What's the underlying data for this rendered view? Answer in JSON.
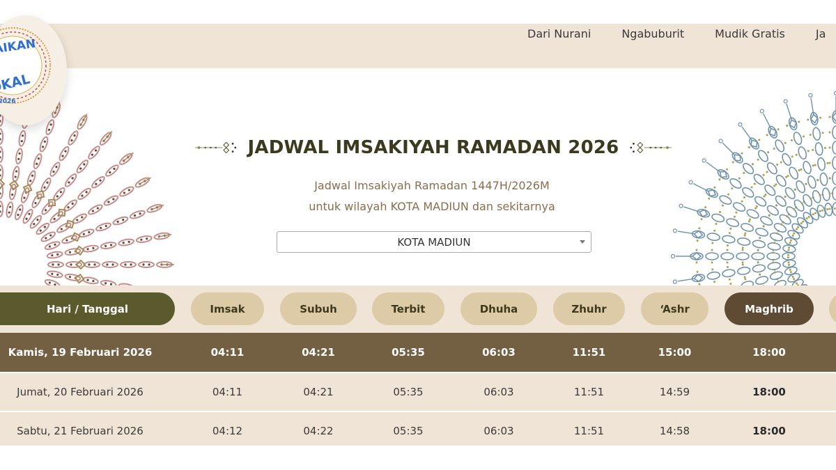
{
  "nav": {
    "items": [
      {
        "label": "Dari Nurani"
      },
      {
        "label": "Ngabuburit"
      },
      {
        "label": "Mudik Gratis"
      },
      {
        "label": "Ja"
      }
    ]
  },
  "logo": {
    "text_top": "AIKAN",
    "text_mid": "OKAL",
    "text_year": "2026"
  },
  "hero": {
    "title": "JADWAL IMSAKIYAH RAMADAN 2026",
    "subtitle_line1": "Jadwal Imsakiyah Ramadan 1447H/2026M",
    "subtitle_line2": "untuk wilayah KOTA MADIUN dan sekitarnya",
    "region_select": {
      "value": "KOTA MADIUN"
    }
  },
  "schedule": {
    "headers": [
      "Hari / Tanggal",
      "Imsak",
      "Subuh",
      "Terbit",
      "Dhuha",
      "Zhuhr",
      "‘Ashr",
      "Maghrib"
    ],
    "active_header": "Maghrib",
    "rows": [
      [
        "Kamis, 19 Februari 2026",
        "04:11",
        "04:21",
        "05:35",
        "06:03",
        "11:51",
        "15:00",
        "18:00"
      ],
      [
        "Jumat, 20 Februari 2026",
        "04:11",
        "04:21",
        "05:35",
        "06:03",
        "11:51",
        "14:59",
        "18:00"
      ],
      [
        "Sabtu, 21 Februari 2026",
        "04:12",
        "04:22",
        "05:35",
        "06:03",
        "11:51",
        "14:58",
        "18:00"
      ]
    ]
  },
  "colors": {
    "page_background": "#ffffff",
    "band": "#efe4d5",
    "pill": "#ddcba7",
    "date_pill": "#5a5a2c",
    "active_pill": "#5f4a33",
    "highlight_row": "#735f41",
    "ornament_left": "#c98b88",
    "ornament_left_accent": "#a58a55",
    "ornament_right": "#6f93ab",
    "ornament_right_accent": "#a9a04c",
    "logo_text": "#2f6fd1"
  }
}
